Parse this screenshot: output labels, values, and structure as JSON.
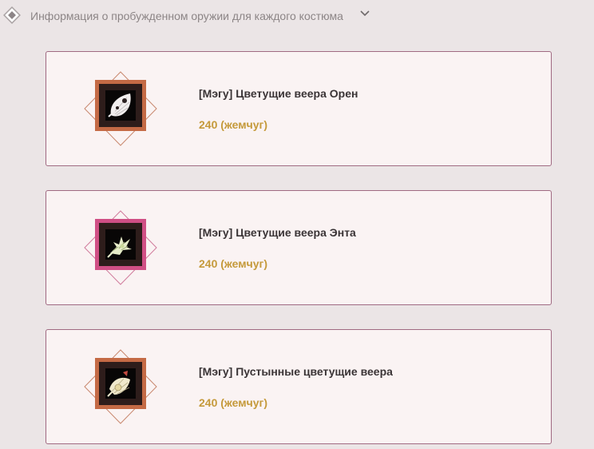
{
  "section": {
    "title": "Информация о пробужденном оружии для каждого костюма",
    "icon": "diamond-icon",
    "toggle_icon": "chevron-down-icon"
  },
  "items": [
    {
      "name": "[Мэгу] Цветущие веера Орен",
      "price": "240 (жемчуг)",
      "frame_color": "#c46a45",
      "icon": "white-fan-icon"
    },
    {
      "name": "[Мэгу] Цветущие веера Энта",
      "price": "240 (жемчуг)",
      "frame_color": "#d04f85",
      "icon": "green-flower-fan-icon"
    },
    {
      "name": "[Мэгу] Пустынные цветущие веера",
      "price": "240 (жемчуг)",
      "frame_color": "#c46a45",
      "icon": "desert-fan-icon"
    }
  ],
  "colors": {
    "background": "#ebe5e6",
    "card_background": "#faf3f3",
    "card_border": "#a06a82",
    "price": "#c59a3b",
    "name": "#3a3436"
  }
}
